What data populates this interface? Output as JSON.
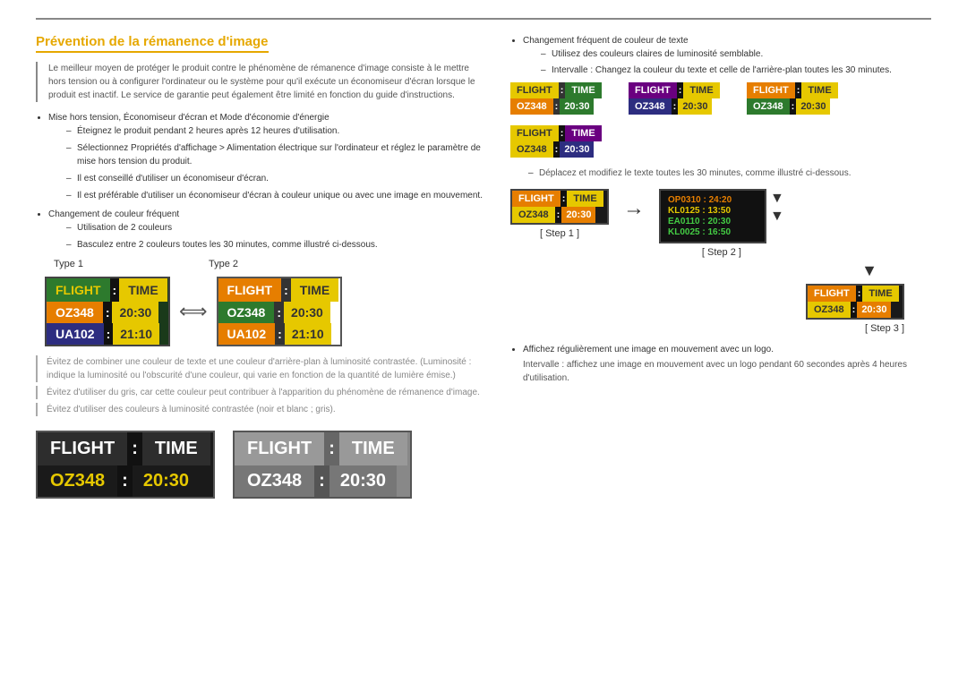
{
  "page": {
    "top_line": true,
    "section_title": "Prévention de la rémanence d'image",
    "intro": "Le meilleur moyen de protéger le produit contre le phénomène de rémanence d'image consiste à le mettre hors tension ou à configurer l'ordinateur ou le système pour qu'il exécute un économiseur d'écran lorsque le produit est inactif. Le service de garantie peut également être limité en fonction du guide d'instructions.",
    "bullets": [
      {
        "text": "Mise hors tension, Économiseur d'écran et Mode d'économie d'énergie",
        "dashes": [
          "Éteignez le produit pendant 2 heures après 12 heures d'utilisation.",
          "Sélectionnez Propriétés d'affichage > Alimentation électrique sur l'ordinateur et réglez le paramètre de mise hors tension du produit.",
          "Il est conseillé d'utiliser un économiseur d'écran.",
          "Il est préférable d'utiliser un économiseur d'écran à couleur unique ou avec une image en mouvement."
        ]
      },
      {
        "text": "Changement de couleur fréquent",
        "dashes": [
          "Utilisation de 2 couleurs",
          "Basculez entre 2 couleurs toutes les 30 minutes, comme illustré ci-dessous."
        ]
      }
    ],
    "type1_label": "Type 1",
    "type2_label": "Type 2",
    "boards_type1": {
      "header": [
        "FLIGHT",
        ":",
        "TIME"
      ],
      "row1": [
        "OZ348",
        ":",
        "20:30"
      ],
      "row2": [
        "UA102",
        ":",
        "21:10"
      ]
    },
    "boards_type2": {
      "header": [
        "FLIGHT",
        ":",
        "TIME"
      ],
      "row1": [
        "OZ348",
        ":",
        "20:30"
      ],
      "row2": [
        "UA102",
        ":",
        "21:10"
      ]
    },
    "warning1": "Évitez de combiner une couleur de texte et une couleur d'arrière-plan à luminosité contrastée. (Luminosité : indique la luminosité ou l'obscurité d'une couleur, qui varie en fonction de la quantité de lumière émise.)",
    "warning2": "Évitez d'utiliser du gris, car cette couleur peut contribuer à l'apparition du phénomène de rémanence d'image.",
    "warning3": "Évitez d'utiliser des couleurs à luminosité contrastée (noir et blanc ; gris).",
    "large_board1": {
      "header": [
        "FLIGHT",
        ":",
        "TIME"
      ],
      "row1": [
        "OZ348",
        ":",
        "20:30"
      ]
    },
    "large_board2": {
      "header": [
        "FLIGHT",
        ":",
        "TIME"
      ],
      "row1": [
        "OZ348",
        ":",
        "20:30"
      ]
    },
    "right": {
      "bullet1": "Changement fréquent de couleur de texte",
      "dash1": "Utilisez des couleurs claires de luminosité semblable.",
      "dash2": "Intervalle : Changez la couleur du texte et celle de l'arrière-plan toutes les 30 minutes.",
      "small_boards": [
        {
          "style": "yellow-green",
          "header": [
            "FLIGHT",
            ":",
            "TIME"
          ],
          "row1": [
            "OZ348",
            ":",
            "20:30"
          ]
        },
        {
          "style": "purple-dark",
          "header": [
            "FLIGHT",
            ":",
            "TIME"
          ],
          "row1": [
            "OZ348",
            ":",
            "20:30"
          ]
        },
        {
          "style": "orange-green",
          "header": [
            "FLIGHT",
            ":",
            "TIME"
          ],
          "row1": [
            "OZ348",
            ":",
            "20:30"
          ]
        },
        {
          "style": "yellow-purple",
          "header": [
            "FLIGHT",
            ":",
            "TIME"
          ],
          "row1": [
            "OZ348",
            ":",
            "20:30"
          ]
        }
      ],
      "note_dash": "Déplacez et modifiez le texte toutes les 30 minutes, comme illustré ci-dessous.",
      "step1_label": "[ Step 1 ]",
      "step2_label": "[ Step 2 ]",
      "step3_label": "[ Step 3 ]",
      "step1_board": {
        "header": [
          "FLIGHT",
          ":",
          "TIME"
        ],
        "row1": [
          "OZ348",
          ":",
          "20:30"
        ]
      },
      "step2_data": [
        {
          "text": "OP0310  :  24:20",
          "color": "orange"
        },
        {
          "text": "KL0125  :  13:50",
          "color": "yellow"
        },
        {
          "text": "EA0110  :  20:30",
          "color": "green"
        },
        {
          "text": "KL0025  :  16:50",
          "color": "green"
        }
      ],
      "step3_board": {
        "header": [
          "FLIGHT",
          ":",
          "TIME"
        ],
        "row1": [
          "OZ348",
          ":",
          "20:30"
        ]
      },
      "note_logo": "Affichez régulièrement une image en mouvement avec un logo.",
      "note_logo2": "Intervalle : affichez une image en mouvement avec un logo pendant 60 secondes après 4 heures d'utilisation."
    }
  }
}
